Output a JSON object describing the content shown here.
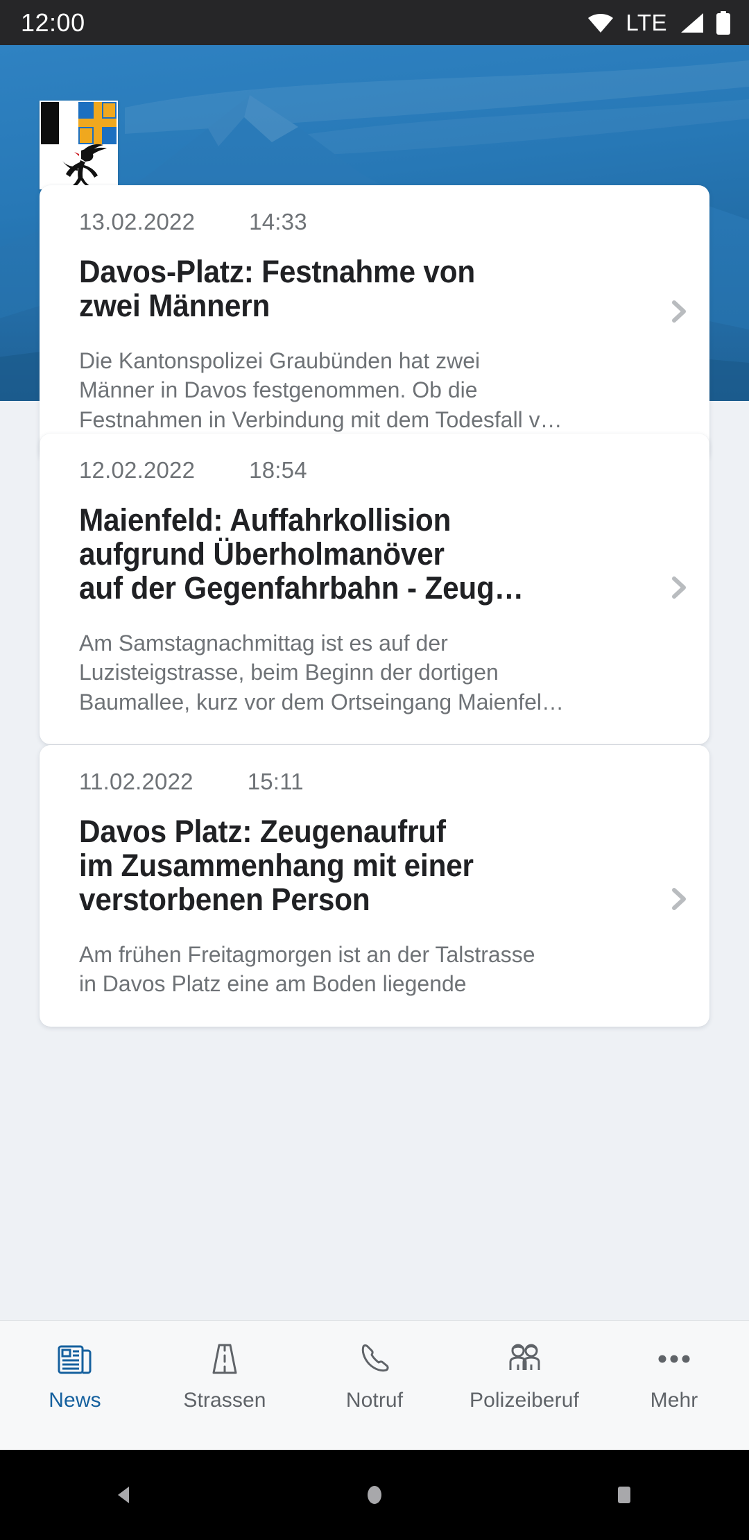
{
  "statusbar": {
    "time": "12:00",
    "network_label": "LTE",
    "icons": [
      "wifi-icon",
      "signal-icon",
      "battery-icon"
    ]
  },
  "hero": {
    "logo_alt": "graubuenden-coat-of-arms",
    "background_alt": "mountain-photo",
    "tint_color": "#1f6dab"
  },
  "colors": {
    "accent": "#15609e",
    "card_bg": "#ffffff",
    "page_bg": "#eef1f5",
    "meta_text": "#6e7276",
    "headline_text": "#202124",
    "tabbar_bg": "#f7f8f9",
    "statusbar_bg": "#262628"
  },
  "news": [
    {
      "date": "13.02.2022",
      "time": "14:33",
      "headline": "Davos-Platz: Festnahme von\nzwei Männern",
      "summary": "Die Kantonspolizei Graubünden hat zwei\nMänner in Davos festgenommen. Ob die\nFestnahmen in Verbindung mit dem Todesfall v…"
    },
    {
      "date": "12.02.2022",
      "time": "18:54",
      "headline": "Maienfeld: Auffahrkollision\naufgrund Überholmanöver\nauf der Gegenfahrbahn - Zeug…",
      "summary": "Am Samstagnachmittag ist es auf der\nLuzisteigstrasse, beim Beginn der dortigen\nBaumallee, kurz vor dem Ortseingang Maienfel…"
    },
    {
      "date": "11.02.2022",
      "time": "15:11",
      "headline": "Davos Platz: Zeugenaufruf\nim Zusammenhang mit einer\nverstorbenen Person",
      "summary": "Am frühen Freitagmorgen ist an der Talstrasse\nin Davos Platz eine am Boden liegende"
    }
  ],
  "tabbar": {
    "items": [
      {
        "label": "News",
        "icon": "newspaper-icon",
        "active": true
      },
      {
        "label": "Strassen",
        "icon": "road-icon",
        "active": false
      },
      {
        "label": "Notruf",
        "icon": "phone-icon",
        "active": false
      },
      {
        "label": "Polizeiberuf",
        "icon": "people-icon",
        "active": false
      },
      {
        "label": "Mehr",
        "icon": "more-dots-icon",
        "active": false
      }
    ]
  },
  "androidnav": {
    "buttons": [
      "back-button",
      "home-button",
      "recents-button"
    ]
  }
}
